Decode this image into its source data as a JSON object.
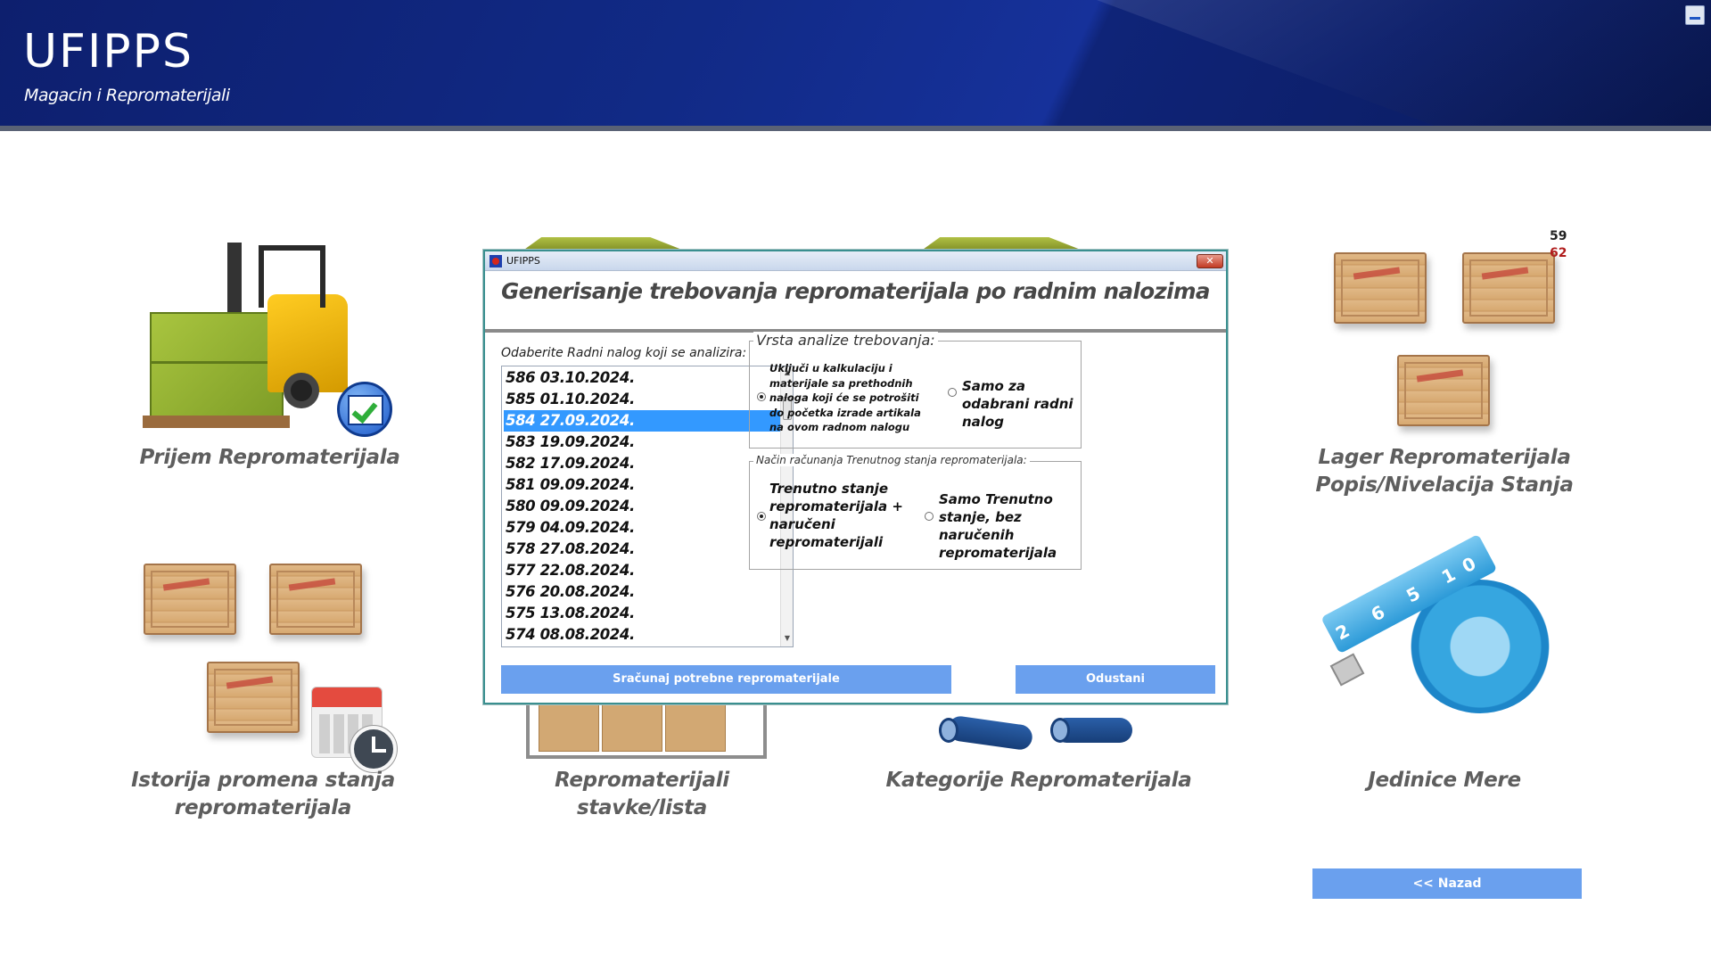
{
  "header": {
    "title": "UFIPPS",
    "subtitle": "Magacin i Repromaterijali"
  },
  "tiles": {
    "prijem": "Prijem Repromaterijala",
    "lager_line1": "Lager Repromaterijala",
    "lager_line2": "Popis/Nivelacija Stanja",
    "istorija_line1": "Istorija promena stanja",
    "istorija_line2": "repromaterijala",
    "stavke_line1": "Repromaterijali",
    "stavke_line2": "stavke/lista",
    "kategorije": "Kategorije Repromaterijala",
    "jedinice": "Jedinice Mere"
  },
  "counts": {
    "first": "59",
    "second": "62",
    "second_color": "#b01c1c"
  },
  "tape_marks": "2 6 5 10",
  "back_button": "<< Nazad",
  "accent_color": "#6aa0ee",
  "dialog": {
    "app_title": "UFIPPS",
    "close_label": "✕",
    "heading": "Generisanje trebovanja repromaterijala po radnim nalozima",
    "list_caption": "Odaberite Radni nalog koji se analizira:",
    "orders": [
      "586 03.10.2024.",
      "585 01.10.2024.",
      "584 27.09.2024.",
      "583 19.09.2024.",
      "582 17.09.2024.",
      "581 09.09.2024.",
      "580 09.09.2024.",
      "579 04.09.2024.",
      "578 27.08.2024.",
      "577 22.08.2024.",
      "576 20.08.2024.",
      "575 13.08.2024.",
      "574 08.08.2024."
    ],
    "selected_order": "584 27.09.2024.",
    "group1": {
      "legend": "Vrsta analize trebovanja:",
      "option1": "Uključi u kalkulaciju i materijale sa prethodnih naloga koji će se potrošiti do početka izrade artikala na ovom radnom nalogu",
      "option2": "Samo za odabrani radni nalog",
      "selected": "option1"
    },
    "group2": {
      "legend": "Način računanja Trenutnog stanja repromaterijala:",
      "option1": "Trenutno stanje repromaterijala + naručeni repromaterijali",
      "option2": "Samo Trenutno stanje, bez naručenih repromaterijala",
      "selected": "option1"
    },
    "calculate_button": "Sračunaj potrebne repromaterijale",
    "cancel_button": "Odustani"
  }
}
